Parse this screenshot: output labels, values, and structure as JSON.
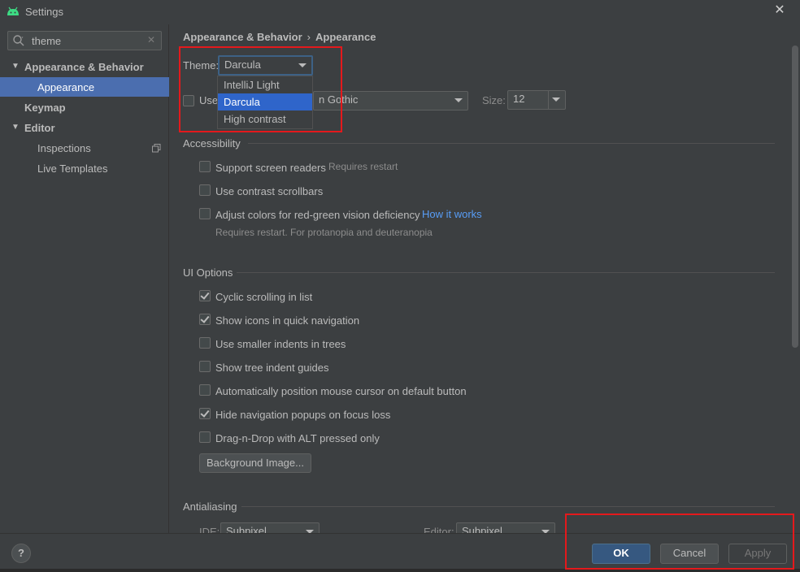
{
  "window": {
    "title": "Settings"
  },
  "search": {
    "value": "theme"
  },
  "sidebar": {
    "items": [
      {
        "label": "Appearance & Behavior"
      },
      {
        "label": "Appearance"
      },
      {
        "label": "Keymap"
      },
      {
        "label": "Editor"
      },
      {
        "label": "Inspections"
      },
      {
        "label": "Live Templates"
      }
    ]
  },
  "breadcrumb": {
    "parent": "Appearance & Behavior",
    "separator": "›",
    "current": "Appearance"
  },
  "theme": {
    "label": "Theme:",
    "selected": "Darcula",
    "options": [
      "IntelliJ Light",
      "Darcula",
      "High contrast"
    ]
  },
  "font": {
    "use_label": "Use",
    "font_value": "n Gothic",
    "size_label": "Size:",
    "size_value": "12"
  },
  "accessibility": {
    "title": "Accessibility",
    "screen_readers": "Support screen readers",
    "screen_readers_note": "Requires restart",
    "contrast_scrollbars": "Use contrast scrollbars",
    "adjust_colors": "Adjust colors for red-green vision deficiency",
    "how_it_works": "How it works",
    "adjust_note": "Requires restart. For protanopia and deuteranopia"
  },
  "ui_options": {
    "title": "UI Options",
    "items": [
      {
        "label": "Cyclic scrolling in list",
        "checked": true
      },
      {
        "label": "Show icons in quick navigation",
        "checked": true
      },
      {
        "label": "Use smaller indents in trees",
        "checked": false
      },
      {
        "label": "Show tree indent guides",
        "checked": false
      },
      {
        "label": "Automatically position mouse cursor on default button",
        "checked": false
      },
      {
        "label": "Hide navigation popups on focus loss",
        "checked": true
      },
      {
        "label": "Drag-n-Drop with ALT pressed only",
        "checked": false
      }
    ],
    "background_image": "Background Image..."
  },
  "antialiasing": {
    "title": "Antialiasing",
    "ide_label": "IDE:",
    "ide_value": "Subpixel",
    "editor_label": "Editor:",
    "editor_value": "Subpixel"
  },
  "footer": {
    "help": "?",
    "ok": "OK",
    "cancel": "Cancel",
    "apply": "Apply"
  },
  "colors": {
    "accent": "#4b6eaf",
    "highlight_box": "#e4191c",
    "link": "#589df6"
  }
}
